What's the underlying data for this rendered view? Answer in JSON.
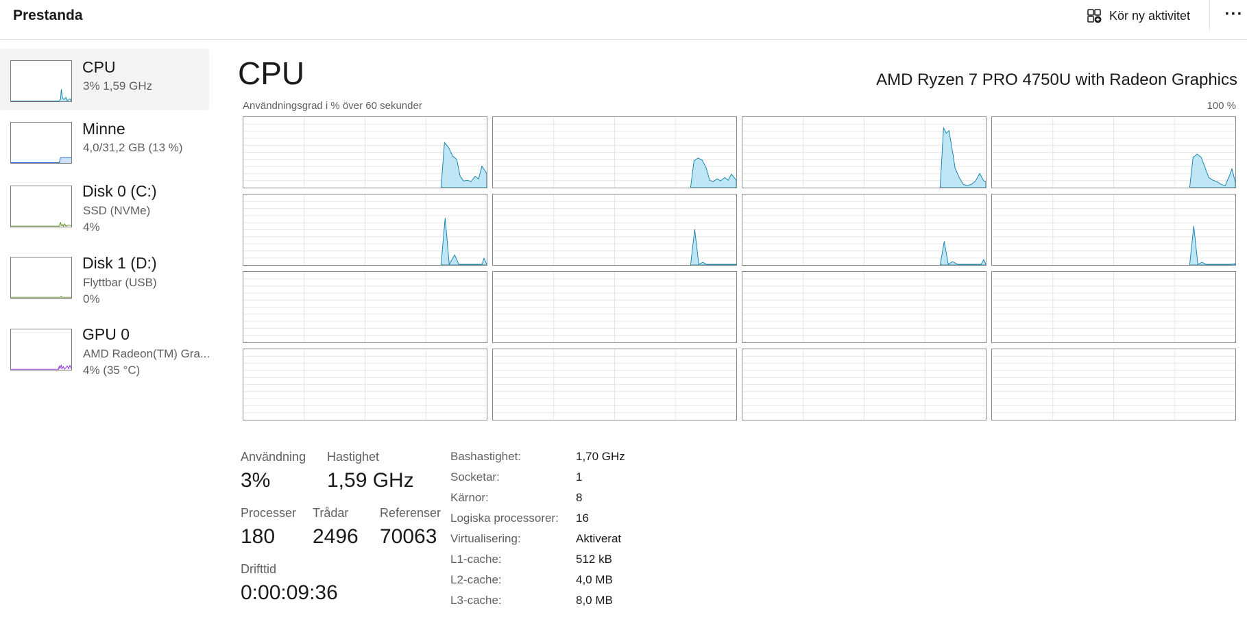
{
  "header": {
    "title": "Prestanda",
    "run_task_label": "Kör ny aktivitet",
    "more_label": "···"
  },
  "sidebar": {
    "items": [
      {
        "name": "CPU",
        "sub1": "3%  1,59 GHz",
        "sub2": "",
        "graph_color": "#1984b0"
      },
      {
        "name": "Minne",
        "sub1": "4,0/31,2 GB (13 %)",
        "sub2": "",
        "graph_color": "#1f6bd4"
      },
      {
        "name": "Disk 0 (C:)",
        "sub1": "SSD (NVMe)",
        "sub2": "4%",
        "graph_color": "#4f8a10"
      },
      {
        "name": "Disk 1 (D:)",
        "sub1": "Flyttbar (USB)",
        "sub2": "0%",
        "graph_color": "#4f8a10"
      },
      {
        "name": "GPU 0",
        "sub1": "AMD Radeon(TM) Gra...",
        "sub2": "4% (35 °C)",
        "graph_color": "#8a2be2"
      }
    ]
  },
  "main": {
    "title": "CPU",
    "model": "AMD Ryzen 7 PRO 4750U with Radeon Graphics",
    "graph_label": "Användningsgrad i % över 60 sekunder",
    "graph_max": "100 %",
    "line_color": "#1984b0",
    "fill_color": "#bfe6f5",
    "grid_color": "#e6e6e6"
  },
  "stats": {
    "usage_label": "Användning",
    "usage_value": "3%",
    "speed_label": "Hastighet",
    "speed_value": "1,59 GHz",
    "processes_label": "Processer",
    "processes_value": "180",
    "threads_label": "Trådar",
    "threads_value": "2496",
    "handles_label": "Referenser",
    "handles_value": "70063",
    "uptime_label": "Drifttid",
    "uptime_value": "0:00:09:36"
  },
  "specs": [
    {
      "label": "Bashastighet:",
      "value": "1,70 GHz"
    },
    {
      "label": "Socketar:",
      "value": "1"
    },
    {
      "label": "Kärnor:",
      "value": "8"
    },
    {
      "label": "Logiska processorer:",
      "value": "16"
    },
    {
      "label": "Virtualisering:",
      "value": "Aktiverat"
    },
    {
      "label": "L1-cache:",
      "value": "512 kB"
    },
    {
      "label": "L2-cache:",
      "value": "4,0 MB"
    },
    {
      "label": "L3-cache:",
      "value": "8,0 MB"
    }
  ]
}
